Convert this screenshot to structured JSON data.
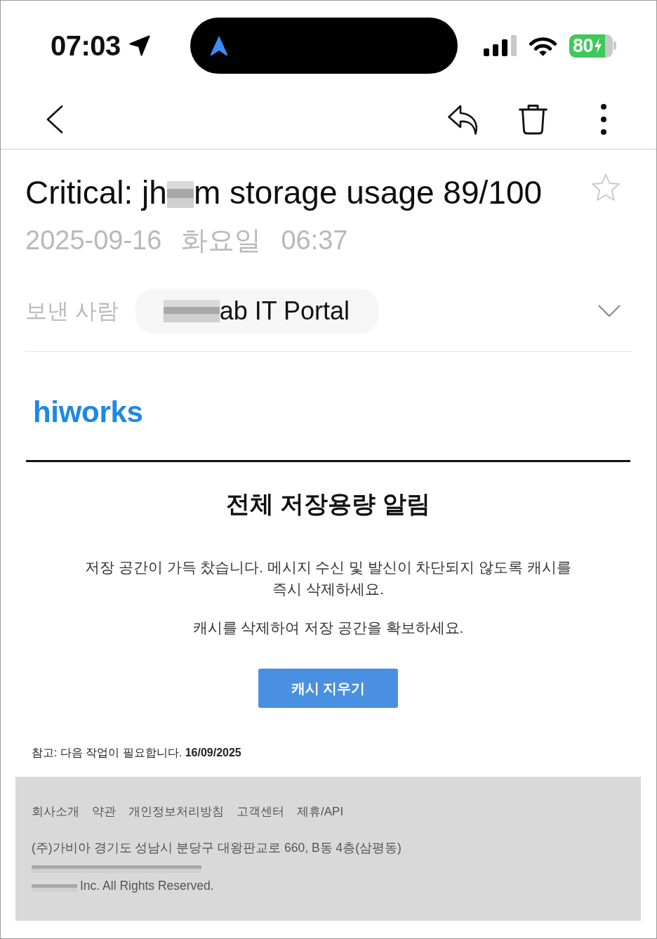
{
  "status_bar": {
    "time": "07:03",
    "battery": {
      "percent": "80",
      "charging": true
    }
  },
  "message": {
    "subject": [
      {
        "kind": "text",
        "text": "Critical: jh"
      },
      {
        "kind": "redacted"
      },
      {
        "kind": "text",
        "text": "m storage usage 89/100"
      }
    ],
    "starred": false,
    "date": "2025-09-16",
    "weekday": "화요일",
    "time": "06:37",
    "sender_label": "보낸 사람",
    "sender": [
      {
        "kind": "redacted"
      },
      {
        "kind": "text",
        "text": "ab IT Portal"
      }
    ],
    "details_expanded": false
  },
  "email_body": {
    "logo": "hiworks",
    "heading": "전체 저장용량 알림",
    "paragraphs": [
      "저장 공간이 가득 찼습니다. 메시지 수신 및 발신이 차단되지 않도록 캐시를 즉시 삭제하세요.",
      "캐시를 삭제하여 저장 공간을 확보하세요."
    ],
    "button": "캐시 지우기",
    "note": "참고: 다음 작업이 필요합니다. **16/09/2025**",
    "footer": {
      "links": [
        "회사소개",
        "약관",
        "개인정보처리방침",
        "고객센터",
        "제휴/API"
      ],
      "lines": [
        [
          {
            "kind": "text",
            "text": "(주)가비아 경기도 성남시 분당구 대왕판교로 660, B동 4층(삼평동)"
          }
        ],
        [
          {
            "kind": "redacted"
          }
        ],
        [
          {
            "kind": "redacted"
          },
          {
            "kind": "text",
            "text": "Inc. All Rights Reserved."
          }
        ]
      ]
    }
  }
}
